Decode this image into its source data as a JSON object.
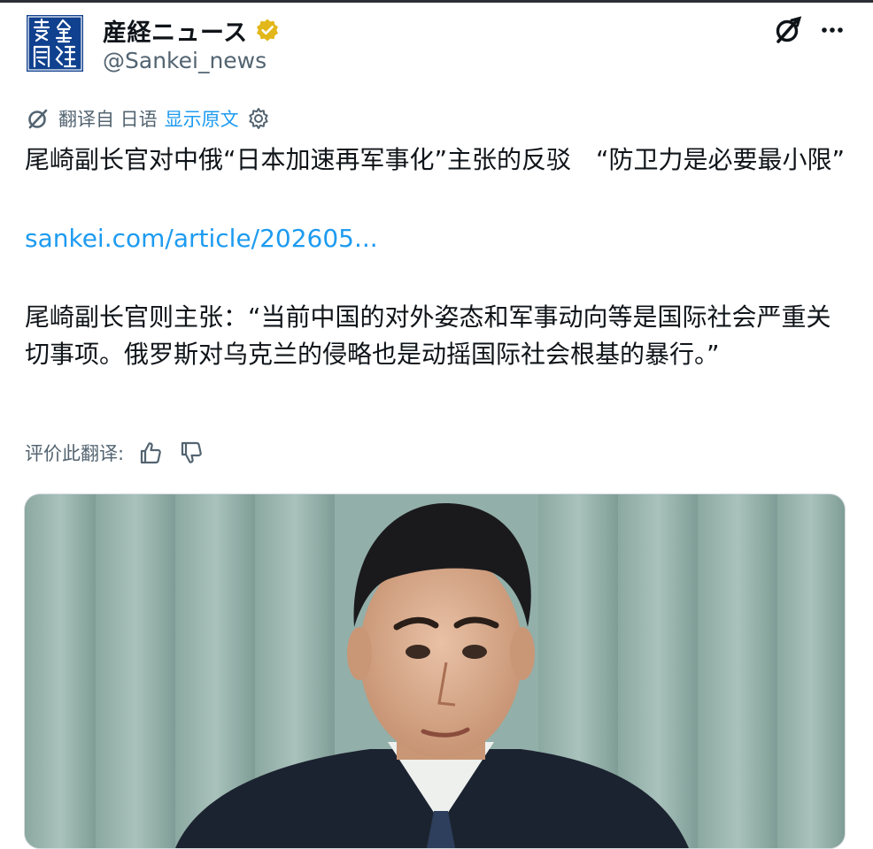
{
  "account": {
    "name": "産経ニュース",
    "handle": "@Sankei_news",
    "verified": true,
    "logo_text": "産經新聞",
    "brand_color": "#10418f",
    "verified_color": "#e2b719"
  },
  "translation": {
    "label": "翻译自 日语",
    "show_original": "显示原文"
  },
  "post": {
    "title": "尾崎副长官对中俄“日本加速再军事化”主张的反驳　“防卫力是必要最小限”",
    "link": "sankei.com/article/202605...",
    "body": "尾崎副长官则主张：“当前中国的对外姿态和军事动向等是国际社会严重关切事项。俄罗斯对乌克兰的侵略也是动摇国际社会根基的暴行。”"
  },
  "rating": {
    "label": "评价此翻译:"
  },
  "icons": {
    "grok": "grok-icon",
    "more": "more-icon",
    "translate": "translate-icon",
    "gear": "gear-icon",
    "thumbs_up": "thumbs-up-icon",
    "thumbs_down": "thumbs-down-icon"
  },
  "colors": {
    "link": "#1d9bf0",
    "secondary_text": "#536471",
    "text": "#0f1419"
  }
}
